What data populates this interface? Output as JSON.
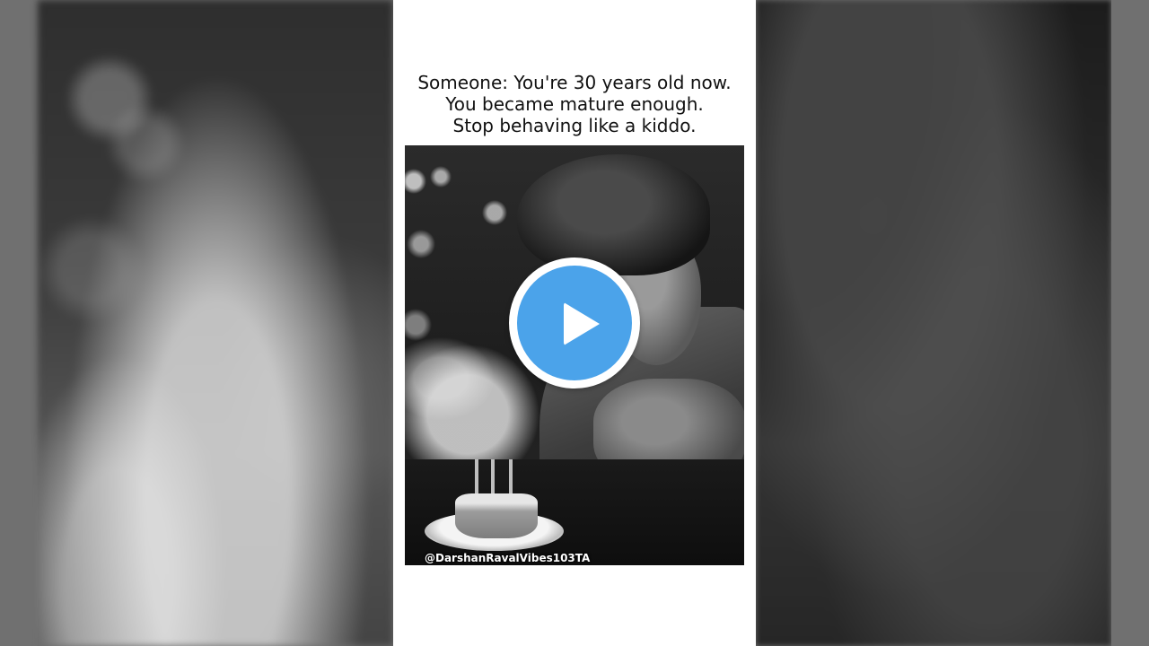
{
  "caption": {
    "line1": "Someone: You're 30 years old now.",
    "line2": "You became mature enough.",
    "line3": "Stop behaving like a kiddo."
  },
  "photo": {
    "watermark": "@DarshanRavalVibes103TA"
  },
  "player": {
    "play_icon": "play-icon",
    "accent_color": "#4ba3ea"
  }
}
